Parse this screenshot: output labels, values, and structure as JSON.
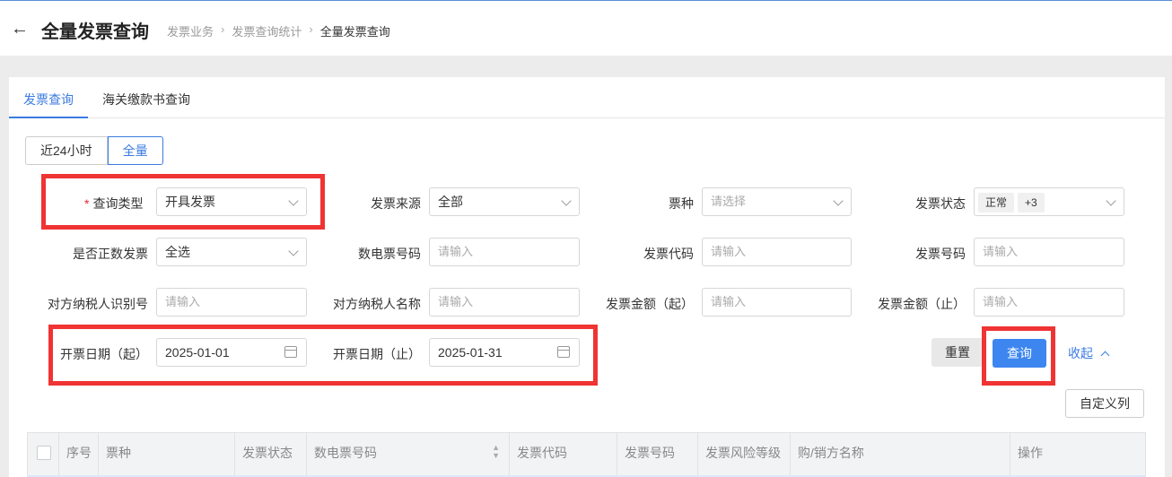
{
  "header": {
    "title": "全量发票查询",
    "breadcrumb": [
      "发票业务",
      "发票查询统计",
      "全量发票查询"
    ]
  },
  "tabs": [
    {
      "label": "发票查询",
      "active": true
    },
    {
      "label": "海关缴款书查询",
      "active": false
    }
  ],
  "range_toggle": {
    "options": [
      "近24小时",
      "全量"
    ],
    "selected": "全量"
  },
  "filters": {
    "query_type": {
      "label": "查询类型",
      "value": "开具发票",
      "required": true
    },
    "invoice_source": {
      "label": "发票来源",
      "value": "全部"
    },
    "ticket_kind": {
      "label": "票种",
      "placeholder": "请选择"
    },
    "invoice_status": {
      "label": "发票状态",
      "tags": [
        "正常",
        "+3"
      ]
    },
    "is_red": {
      "label": "是否正数发票",
      "value": "全选"
    },
    "digital_number": {
      "label": "数电票号码",
      "placeholder": "请输入"
    },
    "invoice_code": {
      "label": "发票代码",
      "placeholder": "请输入"
    },
    "invoice_number": {
      "label": "发票号码",
      "placeholder": "请输入"
    },
    "counterparty_id": {
      "label": "对方纳税人识别号",
      "placeholder": "请输入"
    },
    "counterparty_name": {
      "label": "对方纳税人名称",
      "placeholder": "请输入"
    },
    "amount_from": {
      "label": "发票金额（起）",
      "placeholder": "请输入"
    },
    "amount_to": {
      "label": "发票金额（止）",
      "placeholder": "请输入"
    },
    "date_from": {
      "label": "开票日期（起）",
      "value": "2025-01-01"
    },
    "date_to": {
      "label": "开票日期（止）",
      "value": "2025-01-31"
    }
  },
  "actions": {
    "reset": "重置",
    "query": "查询",
    "collapse": "收起",
    "custom_columns": "自定义列"
  },
  "table": {
    "columns": [
      "序号",
      "票种",
      "发票状态",
      "数电票号码",
      "发票代码",
      "发票号码",
      "发票风险等级",
      "购/销方名称",
      "操作"
    ]
  },
  "colors": {
    "accent": "#3b7be0",
    "highlight": "#f03333"
  }
}
